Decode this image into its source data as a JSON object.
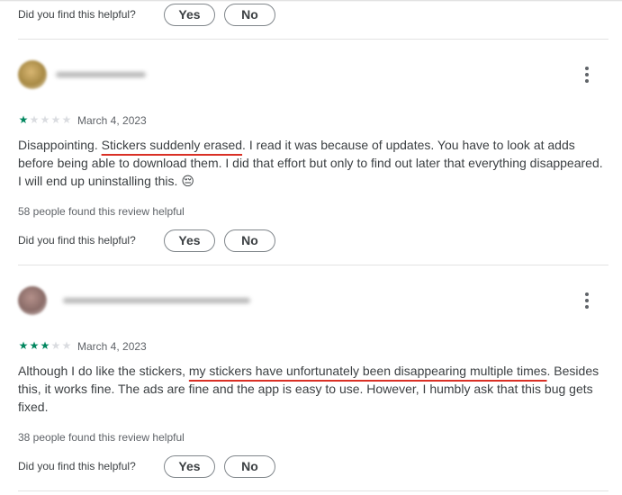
{
  "helpful_prompt": "Did you find this helpful?",
  "yes_label": "Yes",
  "no_label": "No",
  "reviews": [
    {
      "rating": 1,
      "max_rating": 5,
      "date": "March 4, 2023",
      "text_before": "Disappointing. ",
      "text_highlight": "Stickers suddenly erased",
      "text_after": ". I read it was because of updates. You have to look at adds before being able to download them. I did that effort but only to find out later that everything disappeared. I will end up uninstalling this. 😔",
      "helpful_count": "58 people found this review helpful"
    },
    {
      "rating": 3,
      "max_rating": 5,
      "date": "March 4, 2023",
      "text_before": "Although I do like the stickers, ",
      "text_highlight": "my stickers have unfortunately been disappearing multiple times",
      "text_after": ". Besides this, it works fine. The ads are fine and the app is easy to use. However, I humbly ask that this bug gets fixed.",
      "helpful_count": "38 people found this review helpful"
    }
  ],
  "colors": {
    "star_filled": "#01875f",
    "star_empty": "#dadce0",
    "highlight_underline": "#d93025",
    "divider": "#e3e3e3"
  },
  "icons": {
    "star": "star-icon",
    "menu": "more-vert-icon"
  }
}
